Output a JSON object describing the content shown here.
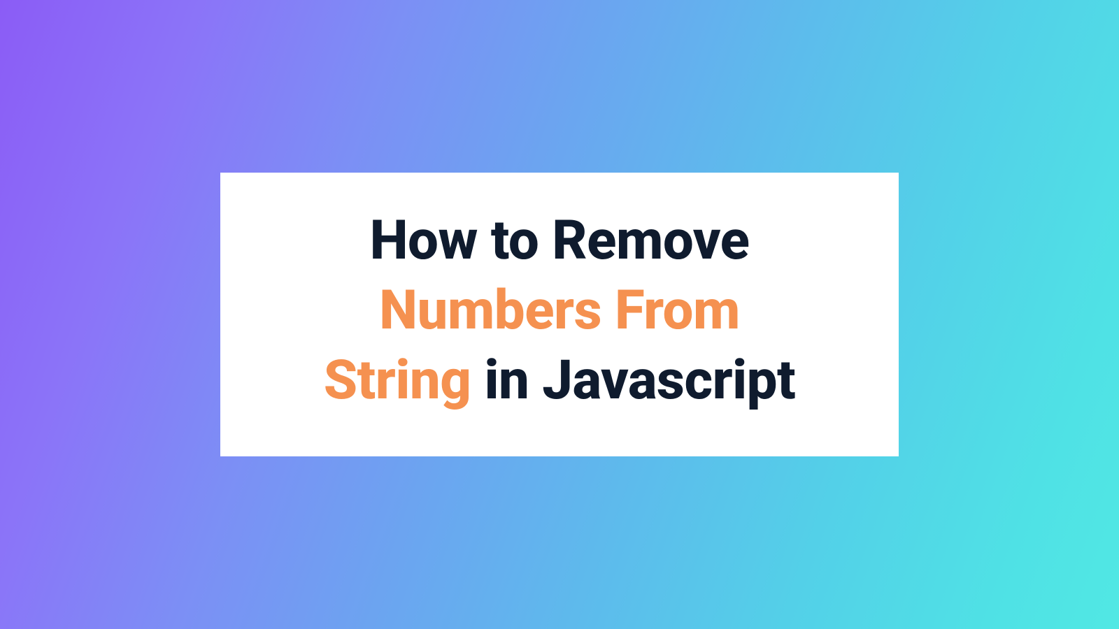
{
  "title": {
    "line1": "How to Remove",
    "line2": "Numbers From",
    "line3_part1": "String",
    "line3_part2": " in Javascript"
  },
  "colors": {
    "dark": "#0f1b2e",
    "orange": "#f59150",
    "gradient_start": "#8b5cf6",
    "gradient_end": "#51e8e4",
    "card_bg": "#ffffff"
  }
}
